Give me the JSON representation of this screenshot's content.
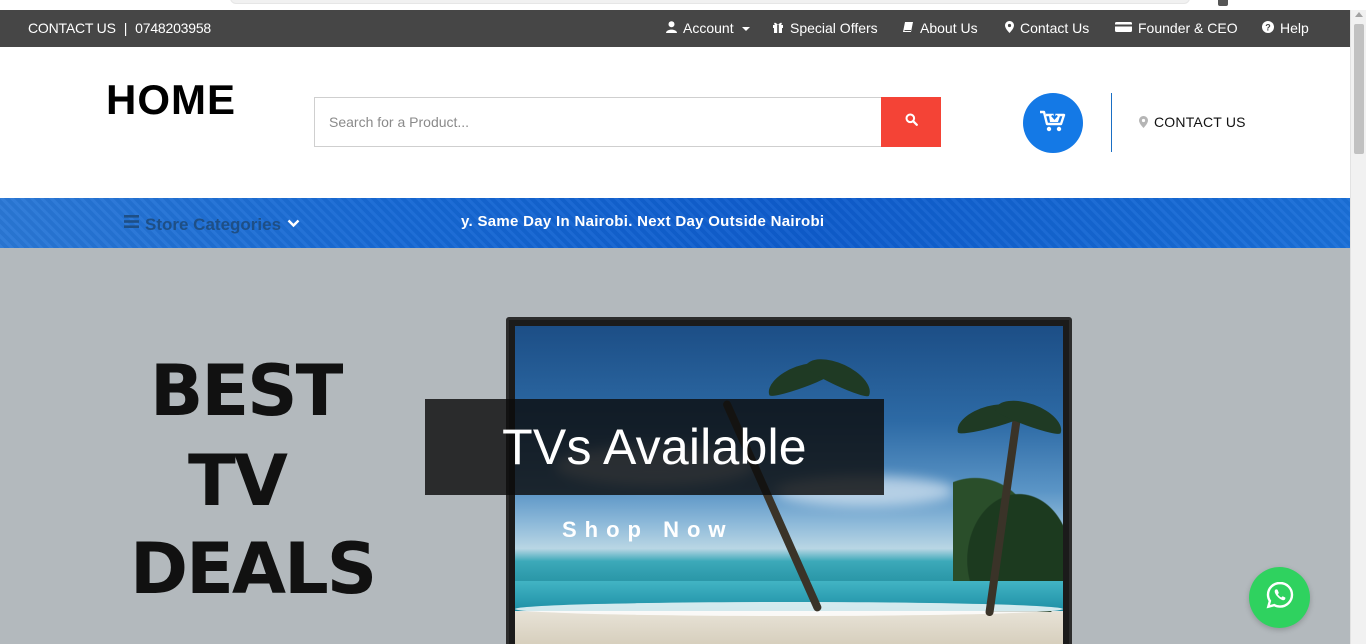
{
  "topbar": {
    "contact_label": "CONTACT US",
    "separator": "|",
    "phone": "0748203958",
    "nav": [
      {
        "label": "Account",
        "icon": "user-icon",
        "has_dropdown": true
      },
      {
        "label": "Special Offers",
        "icon": "gift-icon"
      },
      {
        "label": "About Us",
        "icon": "book-icon"
      },
      {
        "label": "Contact Us",
        "icon": "map-marker-icon"
      },
      {
        "label": "Founder & CEO",
        "icon": "credit-card-icon"
      },
      {
        "label": "Help",
        "icon": "question-circle-icon"
      }
    ]
  },
  "header": {
    "logo": "HOME",
    "contact_label": "CONTACT US"
  },
  "search": {
    "placeholder": "Search for a Product..."
  },
  "categories": {
    "label": "Store Categories"
  },
  "ticker": {
    "text": "y. Same Day In Nairobi. Next Day Outside Nairobi"
  },
  "hero": {
    "deal_lines": [
      "BEST",
      "TV",
      "DEALS"
    ],
    "title": "TVs Available",
    "cta": "Shop Now"
  },
  "colors": {
    "topbar_bg": "#464646",
    "search_button": "#f44336",
    "cart_button": "#1479e6",
    "category_band": "#1668d4",
    "hero_bg": "#b3b9bd",
    "whatsapp": "#2fd25f"
  }
}
